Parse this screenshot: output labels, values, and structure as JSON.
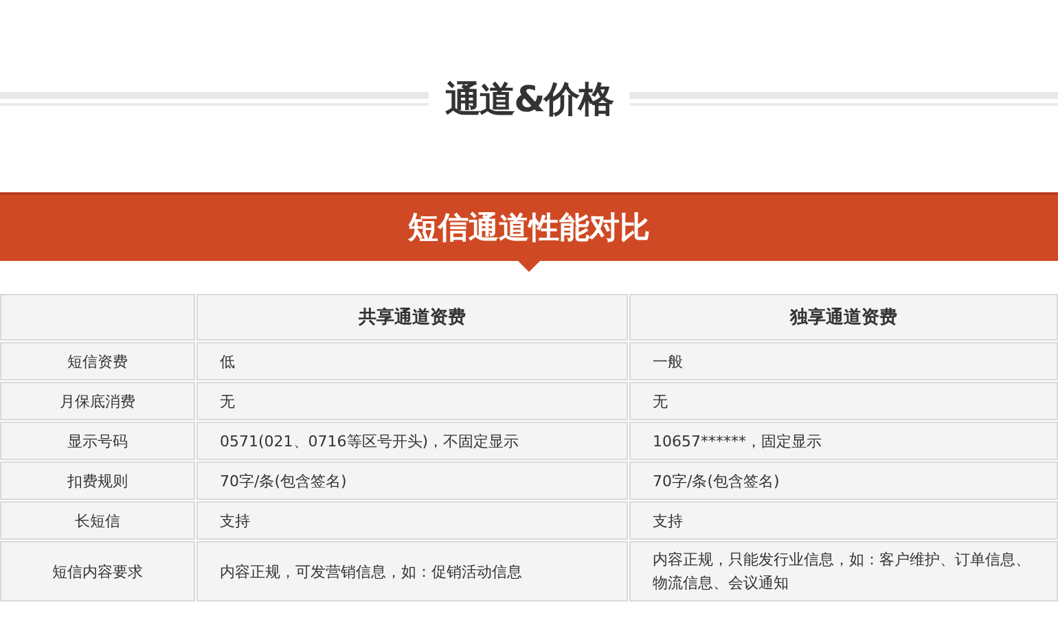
{
  "section_title": "通道&价格",
  "banner": {
    "title": "短信通道性能对比"
  },
  "table": {
    "columns": [
      "",
      "共享通道资费",
      "独享通道资费"
    ],
    "rows": [
      [
        "短信资费",
        "低",
        "一般"
      ],
      [
        "月保底消费",
        "无",
        "无"
      ],
      [
        "显示号码",
        "0571(021、0716等区号开头)，不固定显示",
        "10657******，固定显示"
      ],
      [
        "扣费规则",
        "70字/条(包含签名)",
        "70字/条(包含签名)"
      ],
      [
        "长短信",
        "支持",
        "支持"
      ],
      [
        "短信内容要求",
        "内容正规，可发营销信息，如：促销活动信息",
        "内容正规，只能发行业信息，如：客户维护、订单信息、物流信息、会议通知"
      ]
    ]
  }
}
